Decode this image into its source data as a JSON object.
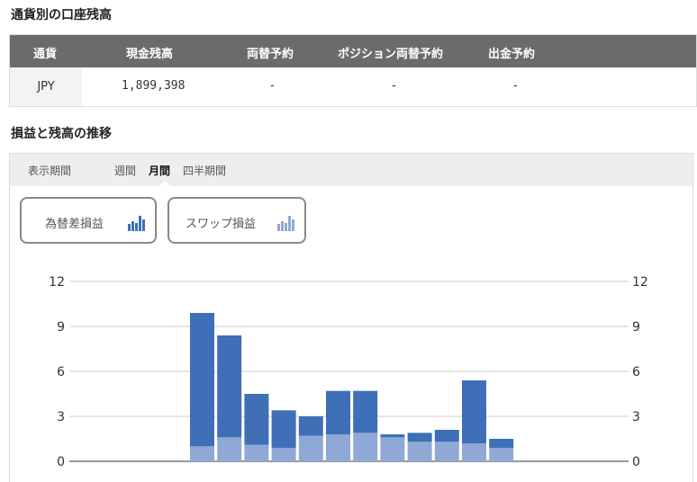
{
  "section1": {
    "title": "通貨別の口座残高",
    "columns": [
      "通貨",
      "現金残高",
      "両替予約",
      "ポジション両替予約",
      "出金予約"
    ],
    "row": {
      "currency": "JPY",
      "cash": "1,899,398",
      "exchange": "-",
      "position_exchange": "-",
      "withdrawal": "-"
    }
  },
  "section2": {
    "title": "損益と残高の推移",
    "period_label": "表示期間",
    "tabs": [
      "週間",
      "月間",
      "四半期間"
    ],
    "selected_tab": "月間",
    "buttons": {
      "fx": "為替差損益",
      "swap": "スワップ損益"
    }
  },
  "colors": {
    "header_bg": "#6b6b6b",
    "dark_bar": "#3e6fb7",
    "light_bar": "#8fa9d7",
    "icon_dark": "#3e6fb7",
    "icon_light": "#8fa9d7"
  },
  "icons": {
    "fx_button": "bar-chart-icon",
    "swap_button": "bar-chart-icon"
  },
  "chart_data": {
    "type": "bar",
    "stacked": true,
    "ylim": [
      0,
      12
    ],
    "yticks": [
      "0",
      "3",
      "6",
      "9",
      "12"
    ],
    "grid": true,
    "bars": 12,
    "series": [
      {
        "values": [
          1.0,
          1.6,
          1.1,
          0.9,
          1.7,
          1.8,
          1.9,
          1.6,
          1.3,
          1.3,
          1.2,
          0.9
        ]
      },
      {
        "values": [
          8.9,
          6.8,
          3.4,
          2.5,
          1.3,
          2.9,
          2.8,
          0.2,
          0.6,
          0.8,
          4.2,
          0.6
        ]
      }
    ]
  }
}
